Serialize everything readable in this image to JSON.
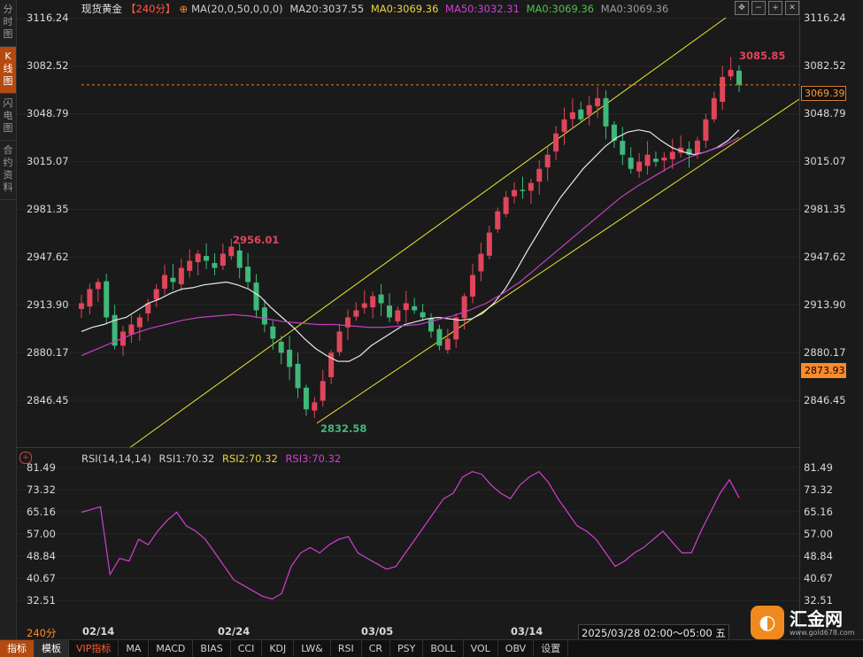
{
  "left_rail": {
    "tabs": [
      {
        "label": "分时图",
        "active": false
      },
      {
        "label": "K线图",
        "active": true
      },
      {
        "label": "闪电图",
        "active": false
      },
      {
        "label": "合约资料",
        "active": false
      }
    ]
  },
  "header": {
    "instrument": "现货黄金",
    "period": "【240分】",
    "settings_icon": "target-icon",
    "ma_params": "MA(20,0,50,0,0,0)",
    "ma20": "MA20:3037.55",
    "ma0_a": "MA0:3069.36",
    "ma50": "MA50:3032.31",
    "ma0_b": "MA0:3069.36",
    "ma0_c": "MA0:3069.36",
    "window_controls": [
      "crosshair-icon",
      "minus-icon",
      "plus-icon",
      "close-icon"
    ]
  },
  "price_axis": {
    "labels": [
      "3116.24",
      "3082.52",
      "3048.79",
      "3015.07",
      "2981.35",
      "2947.62",
      "2913.90",
      "2880.17",
      "2846.45"
    ],
    "current_price": "3069.39",
    "marker_price": "2873.93"
  },
  "annotations": {
    "high": "3085.85",
    "mid_high": "2956.01",
    "low": "2832.58"
  },
  "rsi": {
    "title": "RSI(14,14,14)",
    "rsi1": "RSI1:70.32",
    "rsi2": "RSI2:70.32",
    "rsi3": "RSI3:70.32",
    "axis_labels": [
      "81.49",
      "73.32",
      "65.16",
      "57.00",
      "48.84",
      "40.67",
      "32.51"
    ]
  },
  "x_axis": {
    "labels": [
      "02/14",
      "02/24",
      "03/05",
      "03/14"
    ],
    "period_label": "240分",
    "datetime": "2025/03/28 02:00～05:00 五"
  },
  "logo": {
    "name": "汇金网",
    "url": "www.gold678.com"
  },
  "bottom_tabs": [
    {
      "label": "指标",
      "style": "active"
    },
    {
      "label": "模板",
      "style": "sel"
    },
    {
      "label": "VIP指标",
      "style": "vip"
    },
    {
      "label": "MA",
      "style": ""
    },
    {
      "label": "MACD",
      "style": ""
    },
    {
      "label": "BIAS",
      "style": ""
    },
    {
      "label": "CCI",
      "style": ""
    },
    {
      "label": "KDJ",
      "style": ""
    },
    {
      "label": "LW&",
      "style": ""
    },
    {
      "label": "RSI",
      "style": ""
    },
    {
      "label": "CR",
      "style": ""
    },
    {
      "label": "PSY",
      "style": ""
    },
    {
      "label": "BOLL",
      "style": ""
    },
    {
      "label": "VOL",
      "style": ""
    },
    {
      "label": "OBV",
      "style": ""
    },
    {
      "label": "设置",
      "style": ""
    }
  ],
  "colors": {
    "up": "#e0455a",
    "down": "#3fb87a",
    "ma20": "#e8e8e8",
    "ma50": "#c23fc2",
    "channel": "#e8e832",
    "rsi": "#d23fd2",
    "current_line": "#e07a2a"
  },
  "chart_data": {
    "type": "candlestick",
    "price_range": [
      2832.58,
      3085.85
    ],
    "x_labels": [
      "02/14",
      "02/24",
      "03/05",
      "03/14"
    ],
    "close_path": [
      2915,
      2925,
      2930,
      2905,
      2885,
      2895,
      2900,
      2905,
      2915,
      2925,
      2935,
      2930,
      2940,
      2945,
      2950,
      2945,
      2940,
      2950,
      2955,
      2940,
      2930,
      2910,
      2900,
      2890,
      2880,
      2870,
      2855,
      2840,
      2845,
      2860,
      2880,
      2895,
      2905,
      2910,
      2915,
      2920,
      2915,
      2905,
      2910,
      2915,
      2910,
      2905,
      2895,
      2885,
      2890,
      2905,
      2920,
      2935,
      2950,
      2965,
      2980,
      2990,
      2995,
      2995,
      3000,
      3010,
      3020,
      3035,
      3045,
      3050,
      3045,
      3055,
      3060,
      3040,
      3030,
      3020,
      3010,
      3015,
      3020,
      3015,
      3018,
      3022,
      3025,
      3020,
      3030,
      3045,
      3060,
      3075,
      3080,
      3069.39
    ],
    "ma20": [
      2895,
      2898,
      2900,
      2903,
      2905,
      2910,
      2915,
      2918,
      2922,
      2925,
      2926,
      2928,
      2929,
      2930,
      2928,
      2925,
      2920,
      2912,
      2905,
      2898,
      2890,
      2883,
      2878,
      2874,
      2873.93,
      2878,
      2885,
      2890,
      2895,
      2900,
      2902,
      2904,
      2905,
      2904,
      2903,
      2904,
      2908,
      2915,
      2925,
      2938,
      2952,
      2965,
      2978,
      2990,
      3000,
      3010,
      3018,
      3026,
      3032,
      3036,
      3037.55,
      3036,
      3030,
      3025,
      3022,
      3020,
      3022,
      3025,
      3030,
      3037.55
    ],
    "ma50": [
      2878,
      2883,
      2888,
      2893,
      2897,
      2900,
      2903,
      2905,
      2906,
      2907,
      2906,
      2904,
      2902,
      2901,
      2900,
      2900,
      2899,
      2898,
      2898,
      2899,
      2900,
      2903,
      2906,
      2910,
      2915,
      2922,
      2930,
      2940,
      2950,
      2960,
      2970,
      2980,
      2990,
      2998,
      3005,
      3012,
      3018,
      3022,
      3026,
      3032.31
    ],
    "channel_upper": {
      "from": [
        146,
        506
      ],
      "to": [
        820,
        20
      ]
    },
    "channel_lower": {
      "from": [
        358,
        478
      ],
      "to": [
        903,
        112
      ]
    },
    "rsi_values": [
      65,
      66,
      67,
      42,
      48,
      47,
      55,
      53,
      58,
      62,
      65,
      60,
      58,
      55,
      50,
      45,
      40,
      38,
      36,
      34,
      33,
      35,
      45,
      50,
      52,
      50,
      53,
      55,
      56,
      50,
      48,
      46,
      44,
      45,
      50,
      55,
      60,
      65,
      70,
      72,
      78,
      80,
      79,
      75,
      72,
      70,
      75,
      78,
      80,
      76,
      70,
      65,
      60,
      58,
      55,
      50,
      45,
      47,
      50,
      52,
      55,
      58,
      54,
      50,
      50,
      58,
      65,
      72,
      77,
      70.32
    ],
    "rsi_range": [
      32.51,
      81.49
    ]
  }
}
